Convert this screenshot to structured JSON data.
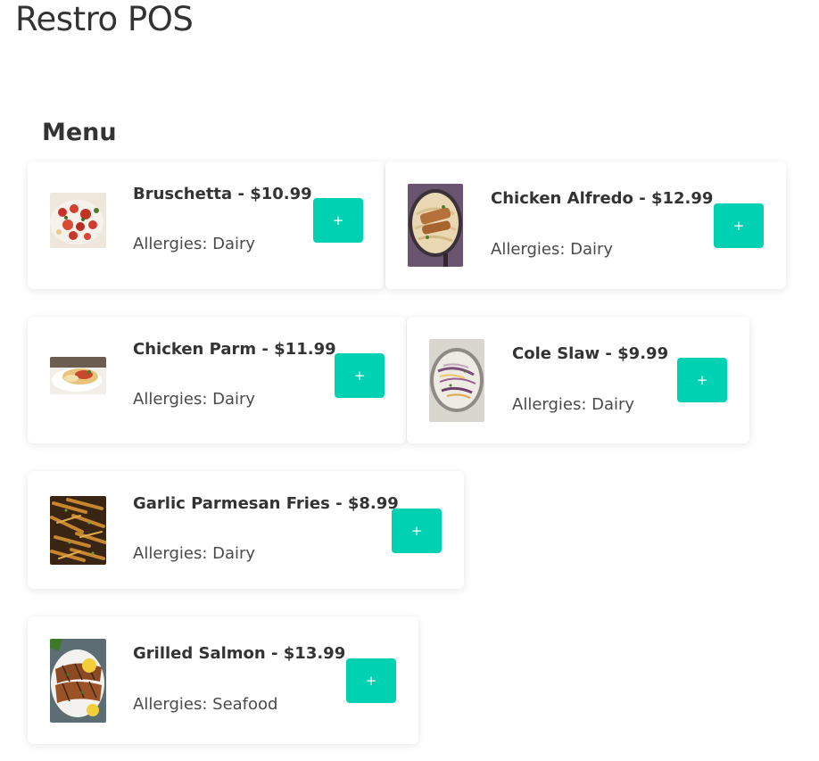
{
  "app": {
    "title": "Restro POS"
  },
  "menu": {
    "heading": "Menu",
    "add_label": "+",
    "allergies_prefix": "Allergies: ",
    "items": [
      {
        "name": "Bruschetta",
        "price": "$10.99",
        "allergies": "Dairy"
      },
      {
        "name": "Chicken Alfredo",
        "price": "$12.99",
        "allergies": "Dairy"
      },
      {
        "name": "Chicken Parm",
        "price": "$11.99",
        "allergies": "Dairy"
      },
      {
        "name": "Cole Slaw",
        "price": "$9.99",
        "allergies": "Dairy"
      },
      {
        "name": "Garlic Parmesan Fries",
        "price": "$8.99",
        "allergies": "Dairy"
      },
      {
        "name": "Grilled Salmon",
        "price": "$13.99",
        "allergies": "Seafood"
      }
    ]
  },
  "colors": {
    "accent": "#00d1b2",
    "text": "#333333"
  }
}
